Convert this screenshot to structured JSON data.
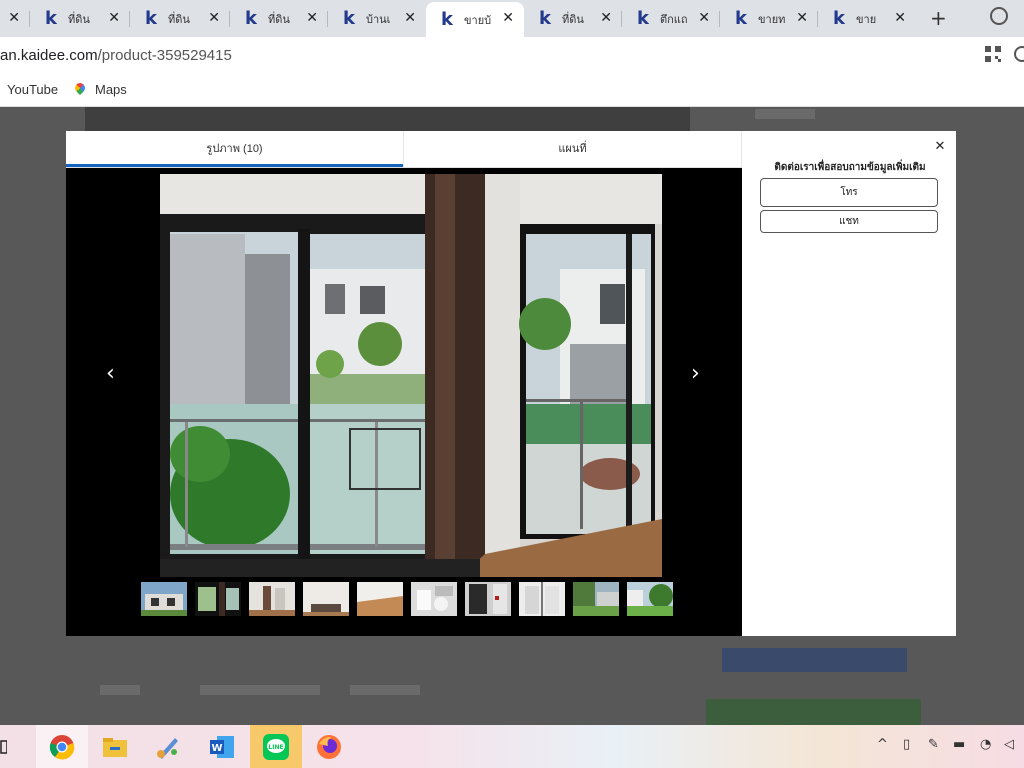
{
  "browser": {
    "tabs": [
      {
        "title": "",
        "active": false
      },
      {
        "title": "ที่ดิน",
        "active": false
      },
      {
        "title": "ที่ดิน",
        "active": false
      },
      {
        "title": "ที่ดิน",
        "active": false
      },
      {
        "title": "บ้านเ",
        "active": false
      },
      {
        "title": "ขายบ้",
        "active": true
      },
      {
        "title": "ที่ดิน",
        "active": false
      },
      {
        "title": "ตึกแถ",
        "active": false
      },
      {
        "title": "ขายท",
        "active": false
      },
      {
        "title": "ขาย",
        "active": false
      }
    ],
    "tab_close_glyph": "✕",
    "new_tab_glyph": "+",
    "url_host": "an.kaidee.com",
    "url_path": "/product-359529415",
    "bookmarks": [
      {
        "label": "YouTube",
        "icon": "youtube-icon"
      },
      {
        "label": "Maps",
        "icon": "maps-icon"
      }
    ]
  },
  "modal": {
    "tabs": [
      {
        "label": "รูปภาพ (10)",
        "active": true
      },
      {
        "label": "แผนที่",
        "active": false
      }
    ],
    "nav_prev": "‹",
    "nav_next": "›",
    "thumbnail_count": 10,
    "selected_thumbnail": 2,
    "side": {
      "close_glyph": "✕",
      "title": "ติดต่อเราเพื่อสอบถามข้อมูลเพิ่มเติม",
      "call_label": "โทร",
      "chat_label": "แชท"
    }
  },
  "taskbar": {
    "apps": [
      "task-view-icon",
      "chrome-icon",
      "file-explorer-icon",
      "paint-icon",
      "word-icon",
      "line-icon",
      "firefox-icon"
    ],
    "tray": [
      "chevron-up-icon",
      "tablet-icon",
      "pen-icon",
      "battery-icon",
      "wifi-icon",
      "volume-icon"
    ]
  }
}
